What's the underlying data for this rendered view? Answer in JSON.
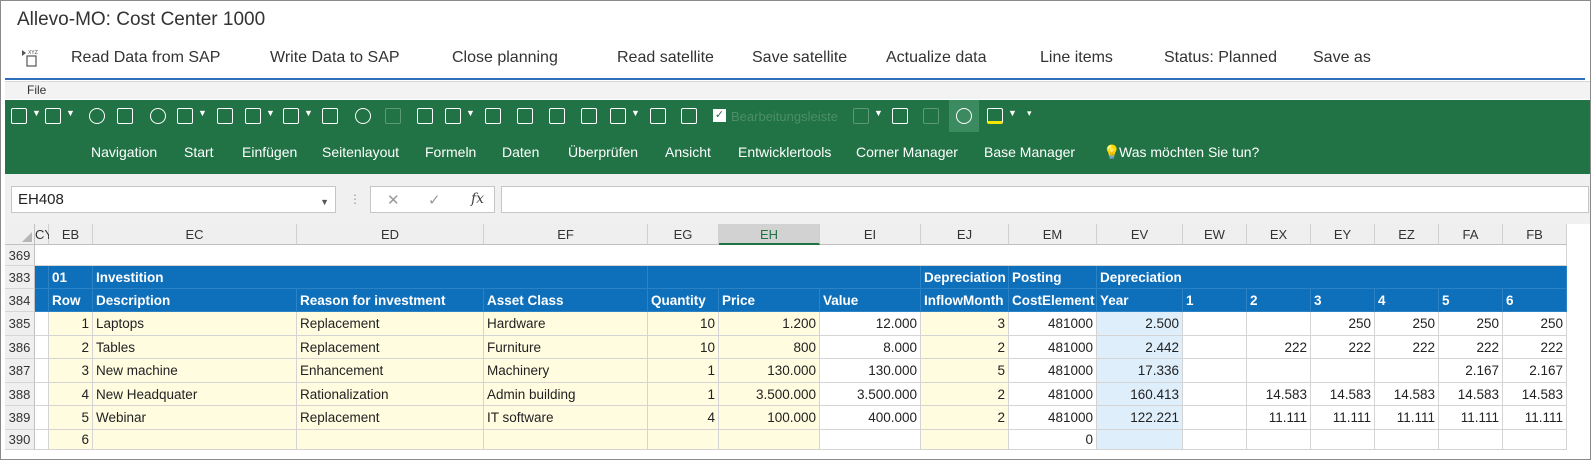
{
  "window": {
    "title": "Allevo-MO: Cost Center 1000"
  },
  "sap_toolbar": {
    "buttons": [
      {
        "id": "read",
        "label": "Read Data from SAP"
      },
      {
        "id": "write",
        "label": "Write Data to SAP"
      },
      {
        "id": "close",
        "label": "Close planning"
      },
      {
        "id": "readsat",
        "label": "Read satellite"
      },
      {
        "id": "savesat",
        "label": "Save satellite"
      },
      {
        "id": "actualize",
        "label": "Actualize data"
      },
      {
        "id": "lineitems",
        "label": "Line items"
      },
      {
        "id": "status",
        "label": "Status: Planned"
      },
      {
        "id": "saveas",
        "label": "Save as"
      }
    ]
  },
  "file_menu": {
    "label": "File"
  },
  "quick_access": {
    "bearbeitungsleiste": "Bearbeitungsleiste"
  },
  "ribbon": {
    "tabs": [
      "Navigation",
      "Start",
      "Einfügen",
      "Seitenlayout",
      "Formeln",
      "Daten",
      "Überprüfen",
      "Ansicht",
      "Entwicklertools",
      "Corner Manager",
      "Base Manager"
    ],
    "tell_me": "Was möchten Sie tun?"
  },
  "formula_bar": {
    "name_box": "EH408",
    "fx": "fx",
    "formula": ""
  },
  "columns": [
    "CY",
    "EB",
    "EC",
    "ED",
    "EF",
    "EG",
    "EH",
    "EI",
    "EJ",
    "EM",
    "EV",
    "EW",
    "EX",
    "EY",
    "EZ",
    "FA",
    "FB"
  ],
  "selected_column": "EH",
  "row_numbers": [
    "369",
    "383",
    "384",
    "385",
    "386",
    "387",
    "388",
    "389",
    "390"
  ],
  "header_row_383": {
    "num": "01",
    "group": "Investition",
    "depreciation": "Depreciation",
    "posting": "Posting",
    "depreciation2": "Depreciation"
  },
  "header_row_384": {
    "row": "Row",
    "description": "Description",
    "reason": "Reason for investment",
    "asset_class": "Asset Class",
    "quantity": "Quantity",
    "price": "Price",
    "value": "Value",
    "inflow": "InflowMonth",
    "cost_element": "CostElement",
    "year": "Year",
    "p1": "1",
    "p2": "2",
    "p3": "3",
    "p4": "4",
    "p5": "5",
    "p6": "6"
  },
  "rows": [
    {
      "n": "1",
      "desc": "Laptops",
      "reason": "Replacement",
      "asset": "Hardware",
      "qty": "10",
      "price": "1.200",
      "value": "12.000",
      "inflow": "3",
      "cost": "481000",
      "year": "2.500",
      "p1": "",
      "p2": "",
      "p3": "250",
      "p4": "250",
      "p5": "250",
      "p6": "250"
    },
    {
      "n": "2",
      "desc": "Tables",
      "reason": "Replacement",
      "asset": "Furniture",
      "qty": "10",
      "price": "800",
      "value": "8.000",
      "inflow": "2",
      "cost": "481000",
      "year": "2.442",
      "p1": "",
      "p2": "222",
      "p3": "222",
      "p4": "222",
      "p5": "222",
      "p6": "222"
    },
    {
      "n": "3",
      "desc": "New machine",
      "reason": "Enhancement",
      "asset": "Machinery",
      "qty": "1",
      "price": "130.000",
      "value": "130.000",
      "inflow": "5",
      "cost": "481000",
      "year": "17.336",
      "p1": "",
      "p2": "",
      "p3": "",
      "p4": "",
      "p5": "2.167",
      "p6": "2.167"
    },
    {
      "n": "4",
      "desc": "New Headquater",
      "reason": "Rationalization",
      "asset": "Admin building",
      "qty": "1",
      "price": "3.500.000",
      "value": "3.500.000",
      "inflow": "2",
      "cost": "481000",
      "year": "160.413",
      "p1": "",
      "p2": "14.583",
      "p3": "14.583",
      "p4": "14.583",
      "p5": "14.583",
      "p6": "14.583"
    },
    {
      "n": "5",
      "desc": "Webinar",
      "reason": "Replacement",
      "asset": "IT software",
      "qty": "4",
      "price": "100.000",
      "value": "400.000",
      "inflow": "2",
      "cost": "481000",
      "year": "122.221",
      "p1": "",
      "p2": "11.111",
      "p3": "11.111",
      "p4": "11.111",
      "p5": "11.111",
      "p6": "11.111"
    },
    {
      "n": "6",
      "desc": "",
      "reason": "",
      "asset": "",
      "qty": "",
      "price": "",
      "value": "",
      "inflow": "",
      "cost": "0",
      "year": "",
      "p1": "",
      "p2": "",
      "p3": "",
      "p4": "",
      "p5": "",
      "p6": ""
    }
  ]
}
